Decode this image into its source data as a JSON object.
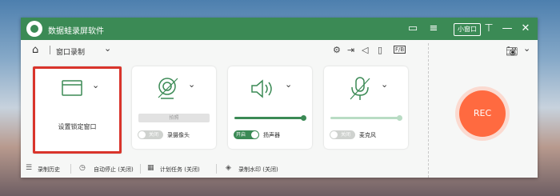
{
  "app": {
    "title": "数据蛙录屏软件",
    "mini_window": "小窗口"
  },
  "toolbar": {
    "mode": "窗口录制"
  },
  "cards": {
    "window_select": {
      "label": "设置锁定窗口"
    },
    "camera": {
      "photo": "拍照",
      "toggle": "关闭",
      "label": "录摄像头"
    },
    "speaker": {
      "toggle": "开启",
      "label": "扬声器",
      "level": 1.0
    },
    "mic": {
      "toggle": "关闭",
      "label": "麦克风",
      "level": 1.0
    }
  },
  "rec": {
    "label": "REC"
  },
  "status": {
    "history": "录制历史",
    "autostop": "自动停止 (关闭)",
    "schedule": "计划任务 (关闭)",
    "watermark": "录制水印 (关闭)"
  },
  "colors": {
    "brand": "#3b8a55",
    "rec": "#ff6a40",
    "selected_border": "#d9342b"
  }
}
